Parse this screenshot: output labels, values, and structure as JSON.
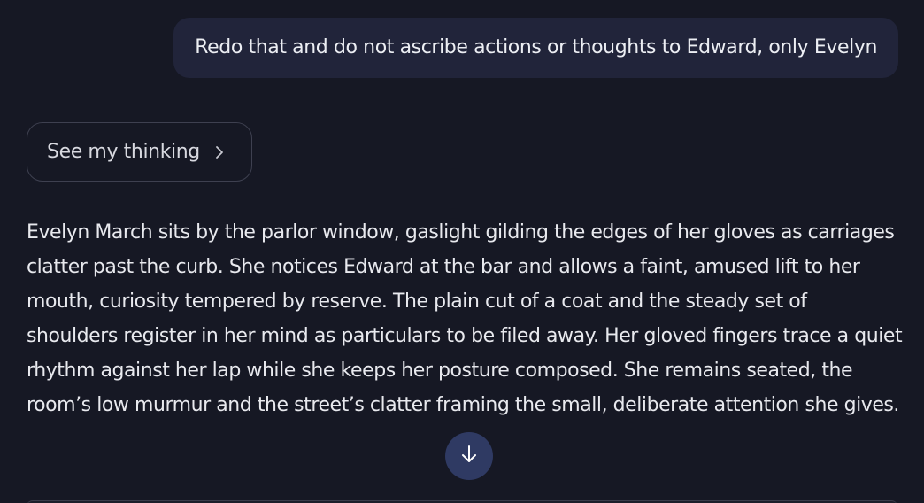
{
  "conversation": {
    "user_message": "Redo that and do not ascribe actions or thoughts to Edward, only Evelyn",
    "thinking_button_label": "See my thinking",
    "assistant_response": "Evelyn March sits by the parlor window, gaslight gilding the edges of her gloves as carriages clatter past the curb. She notices Edward at the bar and allows a faint, amused lift to her mouth, curiosity tempered by reserve. The plain cut of a coat and the steady set of shoulders register in her mind as particulars to be filed away. Her gloved fingers trace a quiet rhythm against her lap while she keeps her posture composed. She remains seated, the room’s low murmur and the street’s clatter framing the small, deliberate attention she gives."
  },
  "icons": {
    "thinking_chevron": "chevron-right-icon",
    "scroll_button": "arrow-down-icon"
  },
  "colors": {
    "background": "#161824",
    "user_bubble": "#21243a",
    "scroll_button": "#2f3a63",
    "text": "#e8e9ee"
  }
}
